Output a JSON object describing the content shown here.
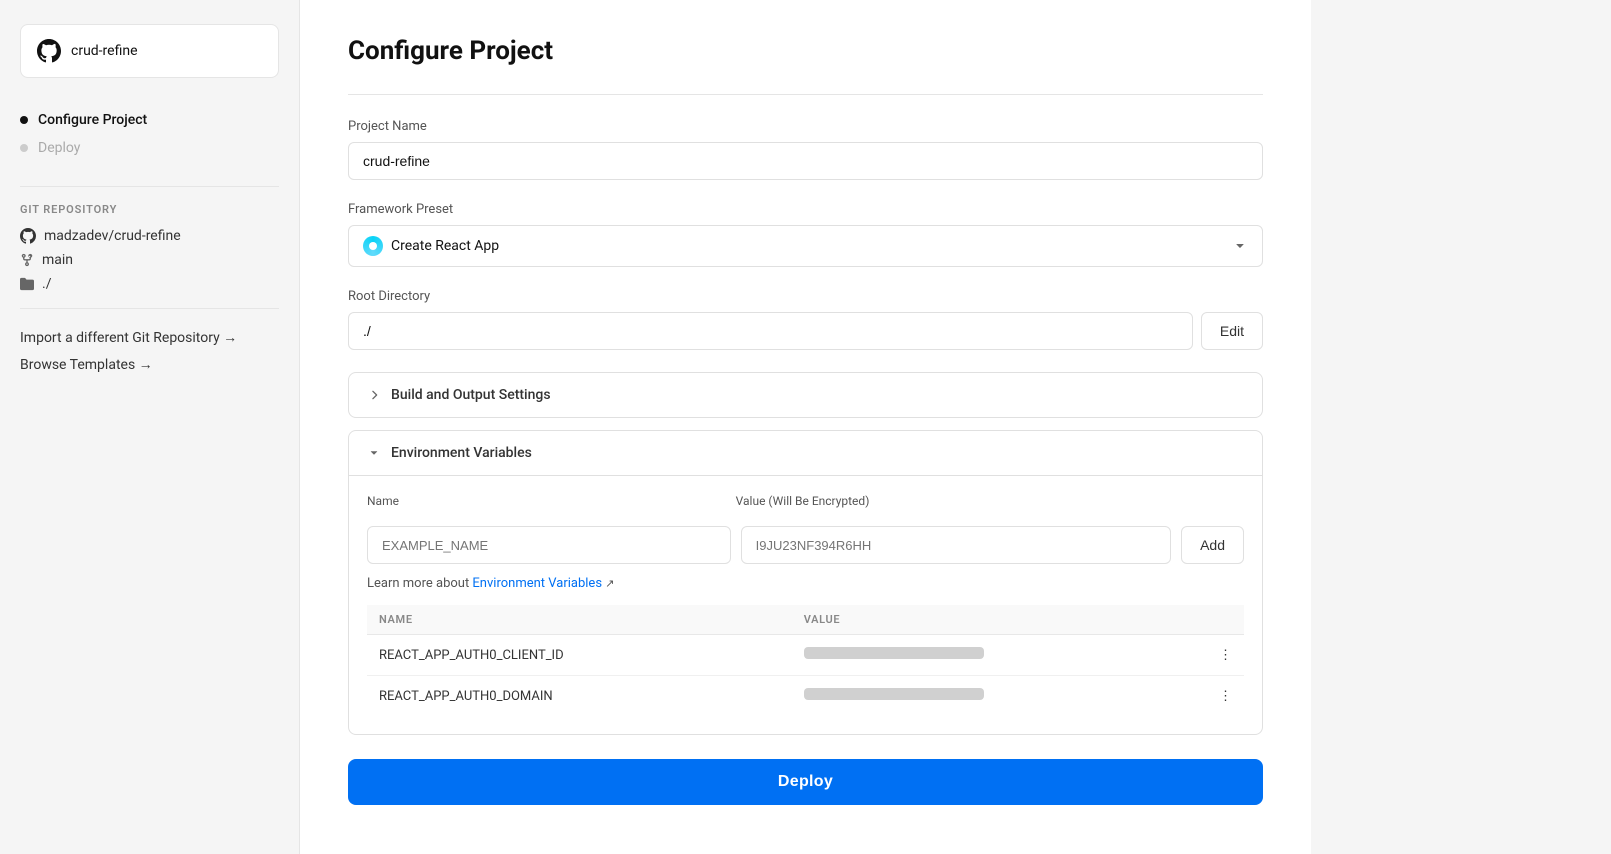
{
  "sidebar": {
    "repo_card": {
      "name": "crud-refine"
    },
    "steps": [
      {
        "id": "configure",
        "label": "Configure Project",
        "active": true
      },
      {
        "id": "deploy",
        "label": "Deploy",
        "active": false
      }
    ],
    "git_section_label": "GIT REPOSITORY",
    "git_repo": "madzadev/crud-refine",
    "git_branch": "main",
    "git_directory": "./",
    "import_link": "Import a different Git Repository →",
    "browse_link": "Browse Templates →"
  },
  "main": {
    "title": "Configure Project",
    "project_name_label": "Project Name",
    "project_name_value": "crud-refine",
    "framework_label": "Framework Preset",
    "framework_value": "Create React App",
    "root_dir_label": "Root Directory",
    "root_dir_value": "./",
    "edit_label": "Edit",
    "build_section_label": "Build and Output Settings",
    "env_section_label": "Environment Variables",
    "env_name_label": "Name",
    "env_value_label": "Value (Will Be Encrypted)",
    "env_name_placeholder": "EXAMPLE_NAME",
    "env_value_placeholder": "I9JU23NF394R6HH",
    "add_label": "Add",
    "learn_more_text": "Learn more about ",
    "env_vars_link": "Environment Variables",
    "table_col_name": "NAME",
    "table_col_value": "VALUE",
    "env_rows": [
      {
        "name": "REACT_APP_AUTH0_CLIENT_ID",
        "value_masked": true
      },
      {
        "name": "REACT_APP_AUTH0_DOMAIN",
        "value_masked": true
      }
    ],
    "deploy_label": "Deploy"
  },
  "icons": {
    "github": "github-icon",
    "chevron_down": "▾",
    "chevron_right": "›",
    "chevron_up": "▴",
    "branch": "⑂",
    "folder": "□",
    "three_dots": "⋮",
    "external_link": "↗"
  }
}
